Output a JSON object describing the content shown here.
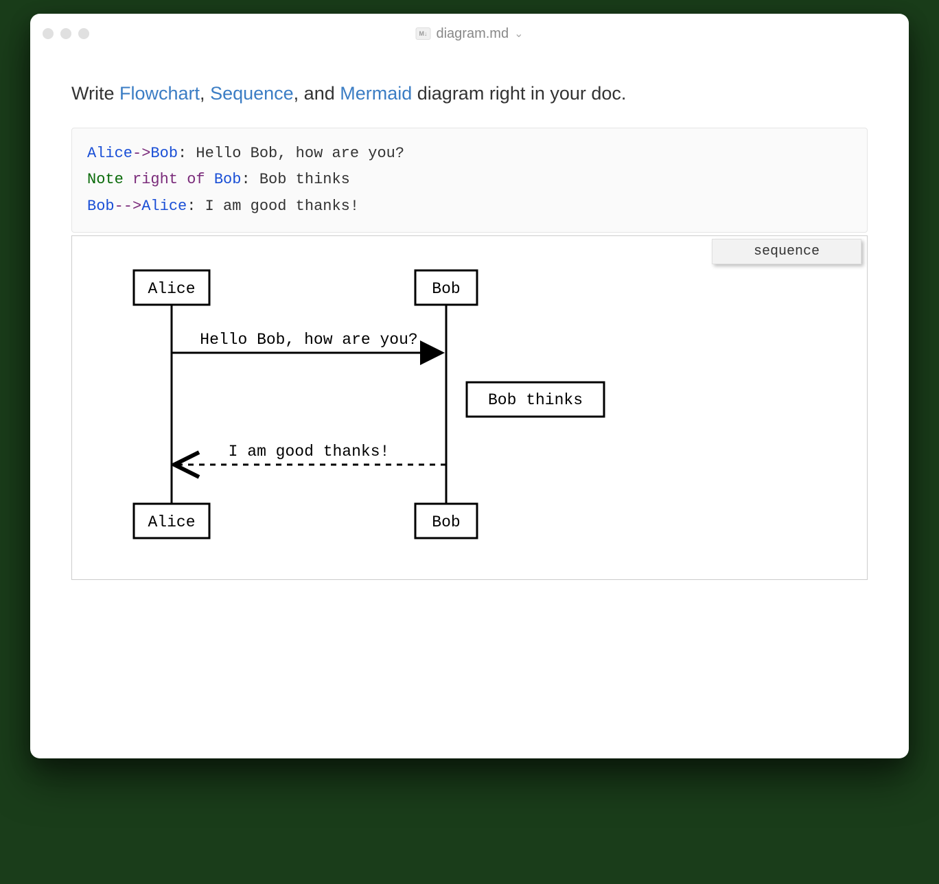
{
  "window": {
    "title": "diagram.md"
  },
  "intro": {
    "prefix": "Write ",
    "link1": "Flowchart",
    "sep1": ", ",
    "link2": "Sequence",
    "sep2": ", and ",
    "link3": "Mermaid",
    "suffix": " diagram right in your doc."
  },
  "code": {
    "line1": {
      "a1": "Alice",
      "arrow": "->",
      "a2": "Bob",
      "rest": ": Hello Bob, how are you?"
    },
    "line2": {
      "k1": "Note",
      "k2": "right of",
      "a": "Bob",
      "rest": ": Bob thinks"
    },
    "line3": {
      "a1": "Bob",
      "arrow": "-->",
      "a2": "Alice",
      "rest": ": I am good thanks!"
    }
  },
  "diagram": {
    "badge": "sequence",
    "actors": {
      "a1": "Alice",
      "a2": "Bob"
    },
    "msg1": "Hello Bob, how are you?",
    "note": "Bob thinks",
    "msg2": "I am good thanks!"
  },
  "chart_data": {
    "type": "sequence",
    "title": "",
    "actors": [
      "Alice",
      "Bob"
    ],
    "events": [
      {
        "type": "message",
        "from": "Alice",
        "to": "Bob",
        "text": "Hello Bob, how are you?",
        "style": "solid"
      },
      {
        "type": "note",
        "placement": "right of",
        "actor": "Bob",
        "text": "Bob thinks"
      },
      {
        "type": "message",
        "from": "Bob",
        "to": "Alice",
        "text": "I am good thanks!",
        "style": "dashed"
      }
    ]
  }
}
